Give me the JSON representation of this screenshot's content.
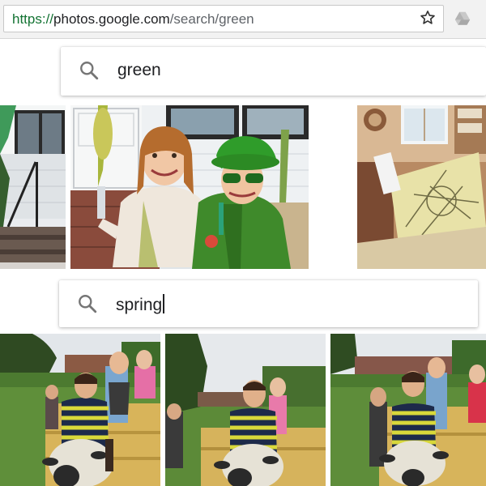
{
  "browser": {
    "url_scheme": "https://",
    "url_host": "photos.google.com",
    "url_path": "/search/green",
    "star_icon": "star-icon",
    "extension_icon": "drive-extension-icon"
  },
  "searches": [
    {
      "query": "green",
      "icon": "search-icon",
      "has_caret": false
    },
    {
      "query": "spring",
      "icon": "search-icon",
      "has_caret": true
    }
  ],
  "colors": {
    "url_scheme": "#137333",
    "url_host": "#202124",
    "url_path": "#5f6368",
    "icon_gray": "#757575"
  }
}
